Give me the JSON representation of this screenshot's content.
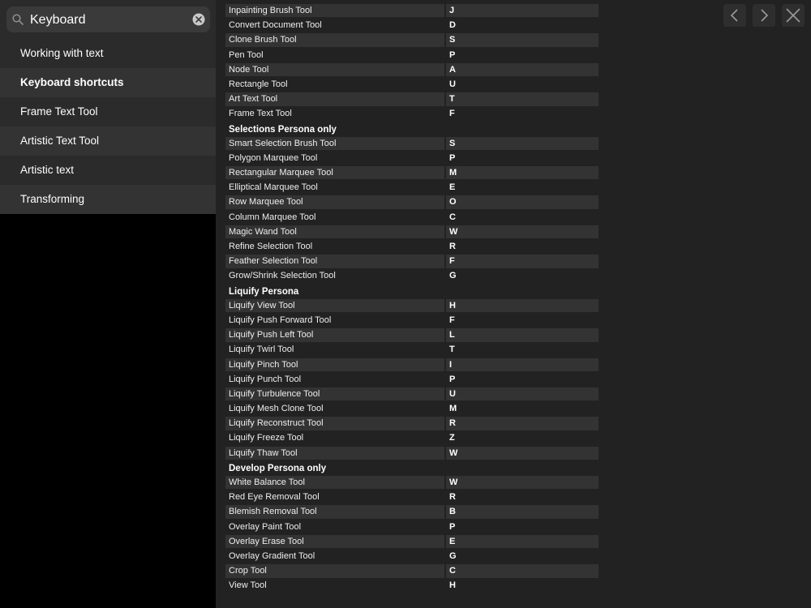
{
  "search": {
    "value": "Keyboard"
  },
  "sidebar": {
    "items": [
      {
        "label": "Working with text"
      },
      {
        "label": "Keyboard shortcuts"
      },
      {
        "label": "Frame Text Tool"
      },
      {
        "label": "Artistic Text Tool"
      },
      {
        "label": "Artistic text"
      },
      {
        "label": "Transforming"
      }
    ],
    "active_index": 1
  },
  "content": {
    "blocks": [
      {
        "type": "row",
        "name": "Inpainting Brush Tool",
        "key": "J"
      },
      {
        "type": "row",
        "name": "Convert Document Tool",
        "key": "D"
      },
      {
        "type": "row",
        "name": "Clone Brush Tool",
        "key": "S"
      },
      {
        "type": "row",
        "name": "Pen Tool",
        "key": "P"
      },
      {
        "type": "row",
        "name": "Node Tool",
        "key": "A"
      },
      {
        "type": "row",
        "name": "Rectangle Tool",
        "key": "U"
      },
      {
        "type": "row",
        "name": "Art Text Tool",
        "key": "T"
      },
      {
        "type": "row",
        "name": "Frame Text Tool",
        "key": "F"
      },
      {
        "type": "section",
        "name": "Selections Persona only"
      },
      {
        "type": "row",
        "name": "Smart Selection Brush Tool",
        "key": "S"
      },
      {
        "type": "row",
        "name": "Polygon Marquee Tool",
        "key": "P"
      },
      {
        "type": "row",
        "name": "Rectangular Marquee Tool",
        "key": "M"
      },
      {
        "type": "row",
        "name": "Elliptical Marquee Tool",
        "key": "E"
      },
      {
        "type": "row",
        "name": "Row Marquee Tool",
        "key": "O"
      },
      {
        "type": "row",
        "name": "Column Marquee Tool",
        "key": "C"
      },
      {
        "type": "row",
        "name": "Magic Wand Tool",
        "key": "W"
      },
      {
        "type": "row",
        "name": "Refine Selection Tool",
        "key": "R"
      },
      {
        "type": "row",
        "name": "Feather Selection Tool",
        "key": "F"
      },
      {
        "type": "row",
        "name": "Grow/Shrink Selection Tool",
        "key": "G"
      },
      {
        "type": "section",
        "name": "Liquify Persona"
      },
      {
        "type": "row",
        "name": "Liquify View Tool",
        "key": "H"
      },
      {
        "type": "row",
        "name": "Liquify Push Forward Tool",
        "key": "F"
      },
      {
        "type": "row",
        "name": "Liquify Push Left Tool",
        "key": "L"
      },
      {
        "type": "row",
        "name": "Liquify Twirl Tool",
        "key": "T"
      },
      {
        "type": "row",
        "name": "Liquify Pinch Tool",
        "key": "I"
      },
      {
        "type": "row",
        "name": "Liquify Punch Tool",
        "key": "P"
      },
      {
        "type": "row",
        "name": "Liquify Turbulence Tool",
        "key": "U"
      },
      {
        "type": "row",
        "name": "Liquify Mesh Clone Tool",
        "key": "M"
      },
      {
        "type": "row",
        "name": "Liquify Reconstruct Tool",
        "key": "R"
      },
      {
        "type": "row",
        "name": "Liquify Freeze Tool",
        "key": "Z"
      },
      {
        "type": "row",
        "name": "Liquify Thaw Tool",
        "key": "W"
      },
      {
        "type": "section",
        "name": "Develop Persona only"
      },
      {
        "type": "row",
        "name": "White Balance Tool",
        "key": "W"
      },
      {
        "type": "row",
        "name": "Red Eye Removal Tool",
        "key": "R"
      },
      {
        "type": "row",
        "name": "Blemish Removal Tool",
        "key": "B"
      },
      {
        "type": "row",
        "name": "Overlay Paint Tool",
        "key": "P"
      },
      {
        "type": "row",
        "name": "Overlay Erase Tool",
        "key": "E"
      },
      {
        "type": "row",
        "name": "Overlay Gradient Tool",
        "key": "G"
      },
      {
        "type": "row",
        "name": "Crop Tool",
        "key": "C"
      },
      {
        "type": "row",
        "name": "View Tool",
        "key": "H"
      }
    ]
  },
  "nav": {
    "icons": [
      "chevron-left-icon",
      "chevron-right-icon",
      "close-icon"
    ]
  },
  "colors": {
    "sidebar_bg": "#2b2b2b",
    "content_bg": "#222222",
    "row_shade": "#333333",
    "text": "#ffffff"
  }
}
